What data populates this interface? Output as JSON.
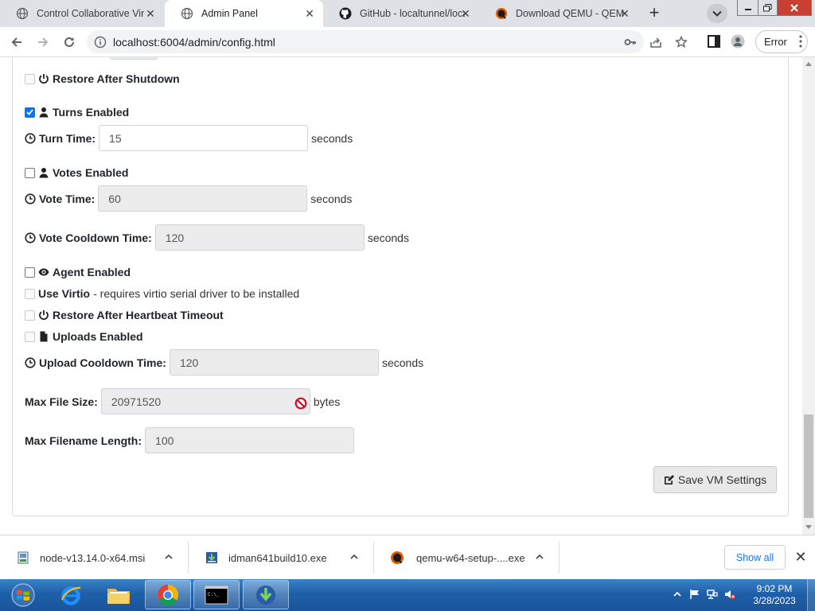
{
  "browser": {
    "tabs": [
      {
        "title": "Control Collaborative Virtual",
        "icon": "globe-icon",
        "active": false
      },
      {
        "title": "Admin Panel",
        "icon": "globe-icon",
        "active": true
      },
      {
        "title": "GitHub - localtunnel/localtunnel",
        "icon": "github-icon",
        "active": false
      },
      {
        "title": "Download QEMU - QEMU",
        "icon": "qemu-icon",
        "active": false
      }
    ],
    "url": "localhost:6004/admin/config.html",
    "profile_status": "Error"
  },
  "form": {
    "restore_shutdown": {
      "label": "Restore After Shutdown",
      "checked": false,
      "disabled": true
    },
    "turns": {
      "label": "Turns Enabled",
      "checked": true
    },
    "turn_time": {
      "label": "Turn Time:",
      "value": "15",
      "unit": "seconds"
    },
    "votes": {
      "label": "Votes Enabled",
      "checked": false
    },
    "vote_time": {
      "label": "Vote Time:",
      "value": "60",
      "unit": "seconds"
    },
    "vote_cooldown": {
      "label": "Vote Cooldown Time:",
      "value": "120",
      "unit": "seconds"
    },
    "agent": {
      "label": "Agent Enabled",
      "checked": false
    },
    "virtio": {
      "label": "Use Virtio",
      "note": "- requires virtio serial driver to be installed",
      "checked": false,
      "disabled": true
    },
    "restore_heartbeat": {
      "label": "Restore After Heartbeat Timeout",
      "checked": false,
      "disabled": true
    },
    "uploads": {
      "label": "Uploads Enabled",
      "checked": false,
      "disabled": true
    },
    "upload_cooldown": {
      "label": "Upload Cooldown Time:",
      "value": "120",
      "unit": "seconds"
    },
    "max_file_size": {
      "label": "Max File Size:",
      "value": "20971520",
      "unit": "bytes"
    },
    "max_filename": {
      "label": "Max Filename Length:",
      "value": "100"
    },
    "save_button": "Save VM Settings"
  },
  "downloads": {
    "items": [
      {
        "name": "node-v13.14.0-x64.msi"
      },
      {
        "name": "idman641build10.exe"
      },
      {
        "name": "qemu-w64-setup-....exe"
      }
    ],
    "show_all": "Show all"
  },
  "taskbar": {
    "time": "9:02 PM",
    "date": "3/28/2023"
  },
  "colors": {
    "checkbox_checked": "#0075ff",
    "taskbar": "#1f5fa8",
    "link": "#1a73e8"
  }
}
